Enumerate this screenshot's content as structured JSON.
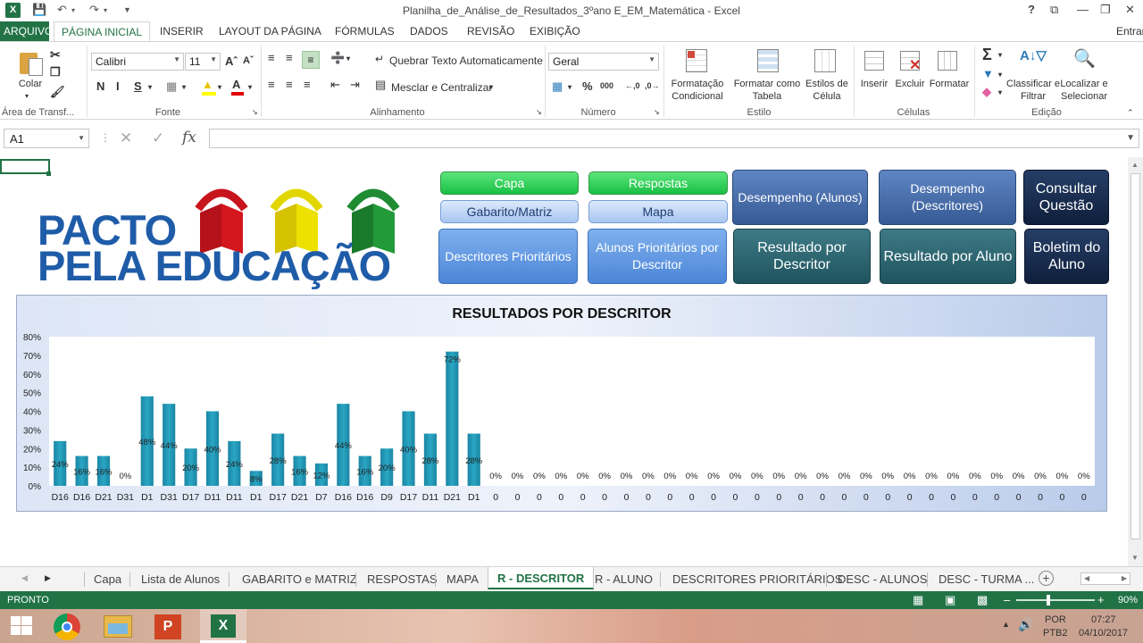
{
  "window": {
    "title": "Planilha_de_Análise_de_Resultados_3ºano E_EM_Matemática - Excel",
    "help": "?",
    "user": "Entrar"
  },
  "ribbon_tabs": [
    "ARQUIVO",
    "PÁGINA INICIAL",
    "INSERIR",
    "LAYOUT DA PÁGINA",
    "FÓRMULAS",
    "DADOS",
    "REVISÃO",
    "EXIBIÇÃO"
  ],
  "ribbon": {
    "paste": "Colar",
    "clipboard_group": "Área de Transf...",
    "font_name": "Calibri",
    "font_size": "11",
    "bold": "N",
    "italic": "I",
    "underline": "S",
    "font_group": "Fonte",
    "wrap_text": "Quebrar Texto Automaticamente",
    "merge_center": "Mesclar e Centralizar",
    "alignment_group": "Alinhamento",
    "number_format": "Geral",
    "number_group": "Número",
    "percent": "%",
    "thousands": "000",
    "conditional_format": "Formatação Condicional",
    "format_table": "Formatar como Tabela",
    "cell_styles": "Estilos de Célula",
    "styles_group": "Estilo",
    "insert": "Inserir",
    "delete": "Excluir",
    "format": "Formatar",
    "cells_group": "Células",
    "sort_filter": "Classificar e Filtrar",
    "find_select": "Localizar e Selecionar",
    "editing_group": "Edição"
  },
  "formula_bar": {
    "name_box": "A1",
    "formula": ""
  },
  "logo": {
    "line1": "PACTO",
    "line2": "PELA EDUCAÇÃO"
  },
  "nav_buttons": {
    "capa": "Capa",
    "gabarito": "Gabarito/Matriz",
    "respostas": "Respostas",
    "mapa": "Mapa",
    "desempenho_alunos": "Desempenho (Alunos)",
    "desempenho_descritores": "Desempenho (Descritores)",
    "consultar_questao": "Consultar Questão",
    "descritores_prioritarios": "Descritores Prioritários",
    "alunos_prioritarios": "Alunos Prioritários por Descritor",
    "resultado_descritor": "Resultado por Descritor",
    "resultado_aluno": "Resultado por Aluno",
    "boletim": "Boletim do Aluno"
  },
  "chart_data": {
    "type": "bar",
    "title": "RESULTADOS POR DESCRITOR",
    "xlabel": "",
    "ylabel": "",
    "ylim": [
      0,
      0.8
    ],
    "yticks": [
      "0%",
      "10%",
      "20%",
      "30%",
      "40%",
      "50%",
      "60%",
      "70%",
      "80%"
    ],
    "categories": [
      "D16",
      "D16",
      "D21",
      "D31",
      "D1",
      "D31",
      "D17",
      "D11",
      "D11",
      "D1",
      "D17",
      "D21",
      "D7",
      "D16",
      "D16",
      "D9",
      "D17",
      "D11",
      "D21",
      "D1",
      "0",
      "0",
      "0",
      "0",
      "0",
      "0",
      "0",
      "0",
      "0",
      "0",
      "0",
      "0",
      "0",
      "0",
      "0",
      "0",
      "0",
      "0",
      "0",
      "0",
      "0",
      "0",
      "0",
      "0",
      "0",
      "0",
      "0",
      "0"
    ],
    "values": [
      0.24,
      0.16,
      0.16,
      0,
      0.48,
      0.44,
      0.2,
      0.4,
      0.24,
      0.08,
      0.28,
      0.16,
      0.12,
      0.44,
      0.16,
      0.2,
      0.4,
      0.28,
      0.72,
      0.28,
      0,
      0,
      0,
      0,
      0,
      0,
      0,
      0,
      0,
      0,
      0,
      0,
      0,
      0,
      0,
      0,
      0,
      0,
      0,
      0,
      0,
      0,
      0,
      0,
      0,
      0,
      0,
      0
    ],
    "labels": [
      "24%",
      "16%",
      "16%",
      "0%",
      "48%",
      "44%",
      "20%",
      "40%",
      "24%",
      "8%",
      "28%",
      "16%",
      "12%",
      "44%",
      "16%",
      "20%",
      "40%",
      "28%",
      "72%",
      "28%",
      "0%",
      "0%",
      "0%",
      "0%",
      "0%",
      "0%",
      "0%",
      "0%",
      "0%",
      "0%",
      "0%",
      "0%",
      "0%",
      "0%",
      "0%",
      "0%",
      "0%",
      "0%",
      "0%",
      "0%",
      "0%",
      "0%",
      "0%",
      "0%",
      "0%",
      "0%",
      "0%",
      "0%"
    ],
    "bar_color": "#2aa6c4",
    "grid": false,
    "legend": "none"
  },
  "sheet_tabs": [
    "Capa",
    "Lista de Alunos",
    "GABARITO e MATRIZ",
    "RESPOSTAS",
    "MAPA",
    "R - DESCRITOR",
    "R - ALUNO",
    "DESCRITORES PRIORITÁRIOS",
    "DESC - ALUNOS",
    "DESC - TURMA ..."
  ],
  "active_sheet": "R - DESCRITOR",
  "status": {
    "mode": "PRONTO",
    "zoom": "90%"
  },
  "taskbar": {
    "lang1": "POR",
    "lang2": "PTB2",
    "time": "07:27",
    "date": "04/10/2017"
  },
  "colors": {
    "excel_green": "#217346",
    "bar": "#2aa6c4"
  }
}
